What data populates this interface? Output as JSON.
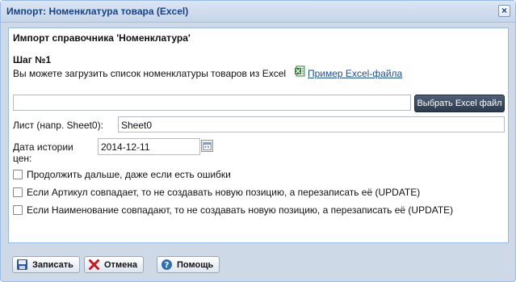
{
  "window": {
    "title": "Импорт: Номенклатура товара (Excel)",
    "close_icon": "close-icon"
  },
  "panel": {
    "heading": "Импорт справочника 'Номенклатура'",
    "step": "Шаг №1",
    "description": "Вы можете загрузить список номенклатуры товаров из Excel",
    "example_link": "Пример Excel-файла",
    "excel_icon": "excel-icon"
  },
  "file": {
    "value": "",
    "browse_label": "Выбрать Excel файл"
  },
  "sheet": {
    "label": "Лист (напр. Sheet0):",
    "value": "Sheet0"
  },
  "price_history_date": {
    "label": "Дата истории цен:",
    "value": "2014-12-11",
    "trigger_icon": "calendar-icon"
  },
  "options": [
    {
      "label": "Продолжить дальше, даже если есть ошибки",
      "checked": false
    },
    {
      "label": "Если Артикул совпадает, то не создавать новую позицию, а перезаписать её (UPDATE)",
      "checked": false
    },
    {
      "label": "Если Наименование совпадают, то не создавать новую позицию, а перезаписать её (UPDATE)",
      "checked": false
    }
  ],
  "buttons": {
    "save": {
      "label": "Записать",
      "icon": "save-icon"
    },
    "cancel": {
      "label": "Отмена",
      "icon": "cancel-icon"
    },
    "help": {
      "label": "Помощь",
      "icon": "help-icon"
    }
  },
  "colors": {
    "window_bg": "#ced9e7",
    "title_text": "#15428b",
    "link": "#1b4fa3",
    "dark_button": "#2c3a4e",
    "cancel_red": "#d3141c",
    "help_blue": "#2f6fb3",
    "save_blue": "#2a5aa8"
  }
}
